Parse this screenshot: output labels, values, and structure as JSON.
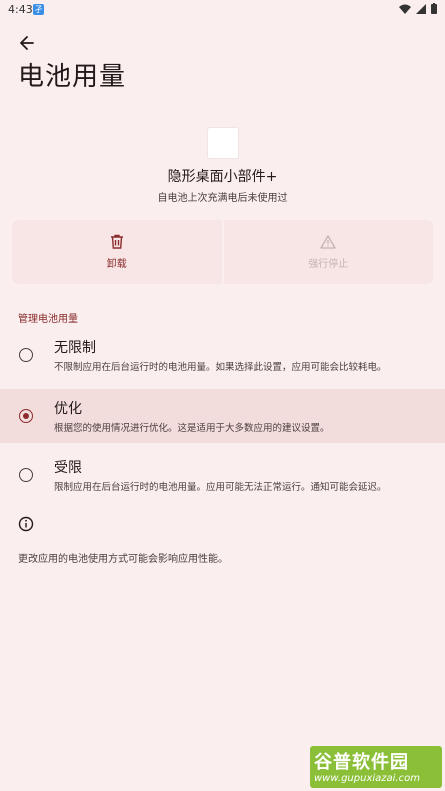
{
  "status_bar": {
    "time": "4:43",
    "notif_glyph": "孑"
  },
  "header": {
    "title": "电池用量"
  },
  "app": {
    "name": "隐形桌面小部件+",
    "subtitle": "自电池上次充满电后未使用过"
  },
  "actions": [
    {
      "label": "卸载",
      "icon": "trash-icon",
      "enabled": true
    },
    {
      "label": "强行停止",
      "icon": "warning-icon",
      "enabled": false
    }
  ],
  "section": {
    "title": "管理电池用量"
  },
  "options": [
    {
      "title": "无限制",
      "desc": "不限制应用在后台运行时的电池用量。如果选择此设置，应用可能会比较耗电。",
      "selected": false
    },
    {
      "title": "优化",
      "desc": "根据您的使用情况进行优化。这是适用于大多数应用的建议设置。",
      "selected": true
    },
    {
      "title": "受限",
      "desc": "限制应用在后台运行时的电池用量。应用可能无法正常运行。通知可能会延迟。",
      "selected": false
    }
  ],
  "info": {
    "text": "更改应用的电池使用方式可能会影响应用性能。"
  },
  "watermark": {
    "main": "谷普软件园",
    "sub": "www.gupuxiazai.com"
  },
  "colors": {
    "background": "#fbeeee",
    "accent": "#8a2c2c",
    "selected_row": "#f3dcdc",
    "watermark": "#8bbf37"
  }
}
